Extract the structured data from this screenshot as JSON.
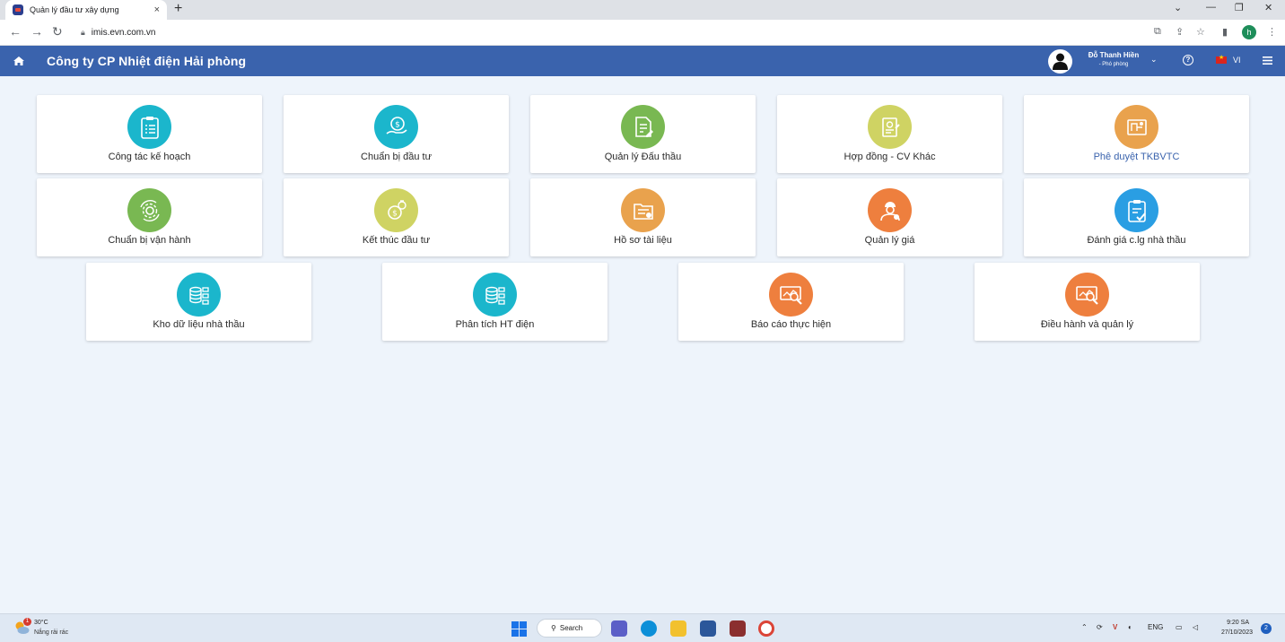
{
  "browser": {
    "tab_title": "Quản lý đầu tư xây dựng",
    "tab_close": "×",
    "new_tab": "+",
    "url": "imis.evn.com.vn",
    "profile_initial": "h"
  },
  "header": {
    "company": "Công ty CP Nhiệt điện Hải phòng",
    "user_name": "Đỗ Thanh Hiền",
    "user_role": "- Phó phòng",
    "language": "VI",
    "colors": {
      "bar": "#3a63ad"
    }
  },
  "cards": [
    {
      "label": "Công tác kế hoạch",
      "icon": "clipboard-list-icon",
      "color": "#1bb6cc"
    },
    {
      "label": "Chuẩn bị đầu tư",
      "icon": "money-hand-icon",
      "color": "#1bb6cc"
    },
    {
      "label": "Quản lý Đấu thầu",
      "icon": "document-edit-icon",
      "color": "#79b852"
    },
    {
      "label": "Hợp đồng - CV Khác",
      "icon": "contract-icon",
      "color": "#cfd363"
    },
    {
      "label": "Phê duyệt TKBVTC",
      "icon": "blueprint-icon",
      "color": "#e9a24d"
    },
    {
      "label": "Chuẩn bị vận hành",
      "icon": "gear-cycle-icon",
      "color": "#79b852"
    },
    {
      "label": "Kết thúc đầu tư",
      "icon": "money-bag-icon",
      "color": "#cfd363"
    },
    {
      "label": "Hồ sơ tài liệu",
      "icon": "folder-icon",
      "color": "#e9a24d"
    },
    {
      "label": "Quản lý giá",
      "icon": "worker-price-icon",
      "color": "#ee7f3e"
    },
    {
      "label": "Đánh giá c.lg nhà thầu",
      "icon": "clipboard-check-icon",
      "color": "#2a9ee3"
    },
    {
      "label": "Kho dữ liệu nhà thầu",
      "icon": "database-icon",
      "color": "#1bb6cc"
    },
    {
      "label": "Phân tích HT điện",
      "icon": "database-icon",
      "color": "#1bb6cc"
    },
    {
      "label": "Báo cáo thực hiện",
      "icon": "report-magnifier-icon",
      "color": "#ee7f3e"
    },
    {
      "label": "Điều hành và quản lý",
      "icon": "report-magnifier-icon",
      "color": "#ee7f3e"
    }
  ],
  "taskbar": {
    "weather_badge": "1",
    "temperature": "30°C",
    "weather_desc": "Nắng rải rác",
    "search_label": "Search",
    "lang": "ENG",
    "time": "9:20 SA",
    "date": "27/10/2023",
    "notifications": "2"
  }
}
